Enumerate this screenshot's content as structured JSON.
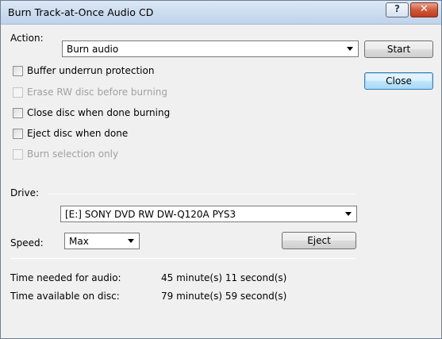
{
  "window": {
    "title": "Burn Track-at-Once Audio CD",
    "help_label": "?",
    "close_label": "✕"
  },
  "action": {
    "label": "Action:",
    "selected": "Burn audio"
  },
  "buttons": {
    "start": "Start",
    "close": "Close",
    "eject": "Eject"
  },
  "options": [
    {
      "label": "Buffer underrun protection",
      "enabled": true,
      "checked": false
    },
    {
      "label": "Erase RW disc before burning",
      "enabled": false,
      "checked": false
    },
    {
      "label": "Close disc when done burning",
      "enabled": true,
      "checked": false
    },
    {
      "label": "Eject disc when done",
      "enabled": true,
      "checked": false
    },
    {
      "label": "Burn selection only",
      "enabled": false,
      "checked": false
    }
  ],
  "drive": {
    "label": "Drive:",
    "selected": "[E:] SONY DVD RW DW-Q120A PYS3"
  },
  "speed": {
    "label": "Speed:",
    "selected": "Max"
  },
  "info": {
    "needed_label": "Time needed for audio:",
    "needed_value": "45 minute(s) 11 second(s)",
    "available_label": "Time available on disc:",
    "available_value": "79 minute(s) 59 second(s)"
  }
}
